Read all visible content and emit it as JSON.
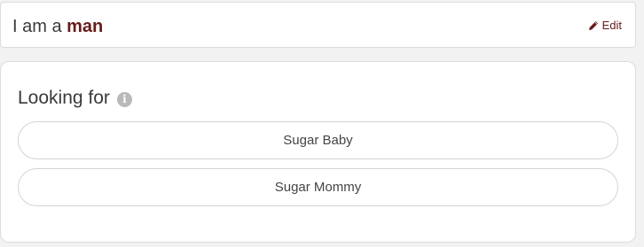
{
  "identity": {
    "prefix": "I am a",
    "gender": "man",
    "edit_label": "Edit"
  },
  "looking_for": {
    "title": "Looking for",
    "options": [
      {
        "label": "Sugar Baby"
      },
      {
        "label": "Sugar Mommy"
      }
    ]
  },
  "icons": {
    "edit": "pencil-icon",
    "info": "info-icon"
  },
  "colors": {
    "accent": "#6b1a1a",
    "text": "#3a3a3a",
    "info_icon": "#b9b9b9",
    "background": "#f2f2f2",
    "card": "#ffffff",
    "border": "#dcdcdc"
  }
}
